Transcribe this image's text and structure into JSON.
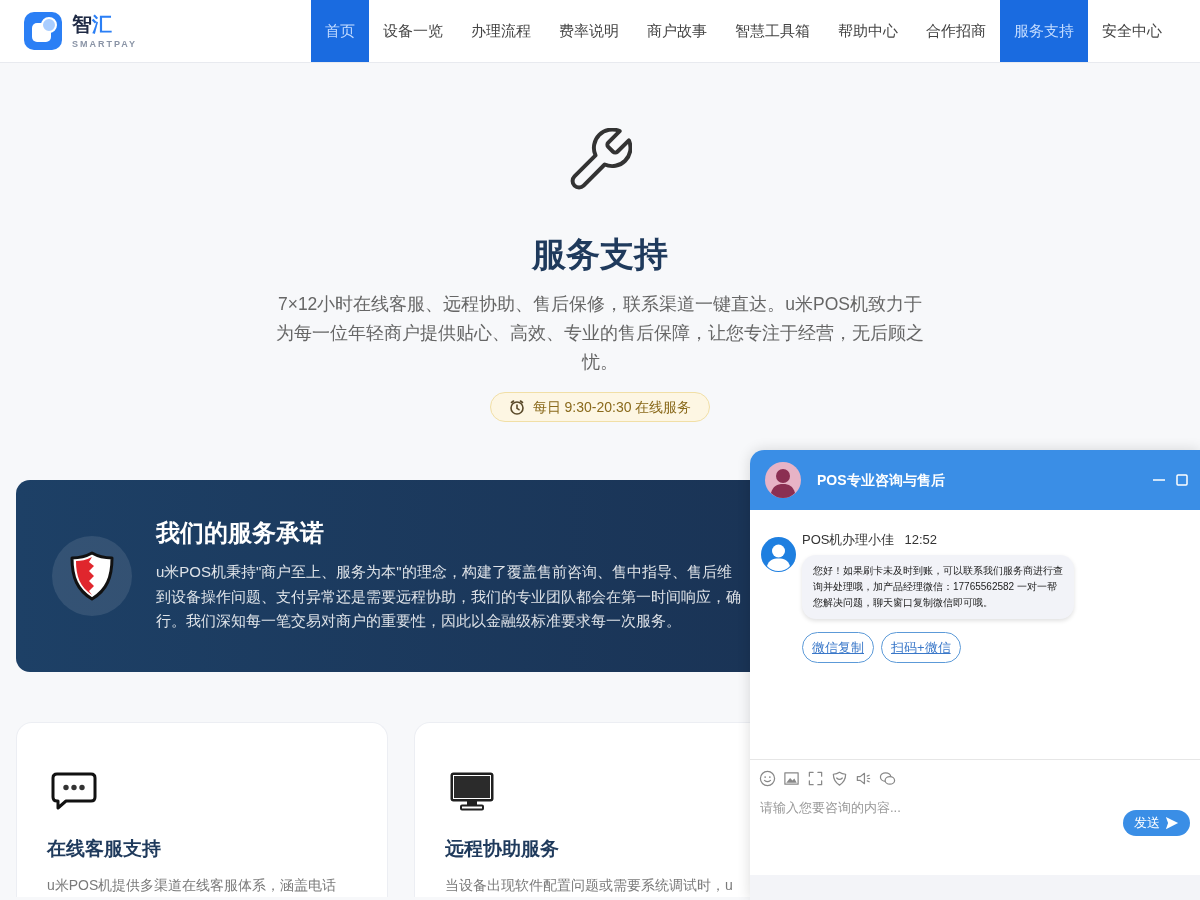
{
  "header": {
    "logo": {
      "name": "智汇",
      "tagline": "SMARTPAY"
    },
    "nav": [
      {
        "label": "首页",
        "selected": true
      },
      {
        "label": "设备一览",
        "selected": false
      },
      {
        "label": "办理流程",
        "selected": false
      },
      {
        "label": "费率说明",
        "selected": false
      },
      {
        "label": "商户故事",
        "selected": false
      },
      {
        "label": "智慧工具箱",
        "selected": false
      },
      {
        "label": "帮助中心",
        "selected": false
      },
      {
        "label": "合作招商",
        "selected": false
      },
      {
        "label": "服务支持",
        "selected": true
      },
      {
        "label": "安全中心",
        "selected": false
      }
    ]
  },
  "hero": {
    "title": "服务支持",
    "description": "7×12小时在线客服、远程协助、售后保修，联系渠道一键直达。u米POS机致力于为每一位年轻商户提供贴心、高效、专业的售后保障，让您专注于经营，无后顾之忧。",
    "hours_badge": "每日 9:30-20:30 在线服务"
  },
  "commitment": {
    "title": "我们的服务承诺",
    "text_lines": [
      "u米POS机秉持\"商户至上、服务为本\"的理念，构建了覆盖售前咨询、售中指导、售后维",
      "到设备操作问题、支付异常还是需要远程协助，我们的专业团队都会在第一时间响应，确",
      "行。我们深知每一笔交易对商户的重要性，因此以金融级标准要求每一次服务。"
    ]
  },
  "features": [
    {
      "title": "在线客服支持",
      "description": "u米POS机提供多渠道在线客服体系，涵盖电话"
    },
    {
      "title": "远程协助服务",
      "description": "当设备出现软件配置问题或需要系统调试时，u"
    }
  ],
  "chat_widget": {
    "title": "POS专业咨询与售后",
    "messages": [
      {
        "sender": "POS机办理小佳",
        "time": "12:52",
        "text": "您好！如果刷卡未及时到账，可以联系我们服务商进行查询并处理哦，加产品经理微信：17765562582 一对一帮您解决问题，聊天窗口复制微信即可哦。"
      }
    ],
    "quick_replies": [
      "微信复制",
      "扫码+微信"
    ],
    "input": {
      "placeholder": "请输入您要咨询的内容..."
    },
    "send_button": "发送"
  }
}
